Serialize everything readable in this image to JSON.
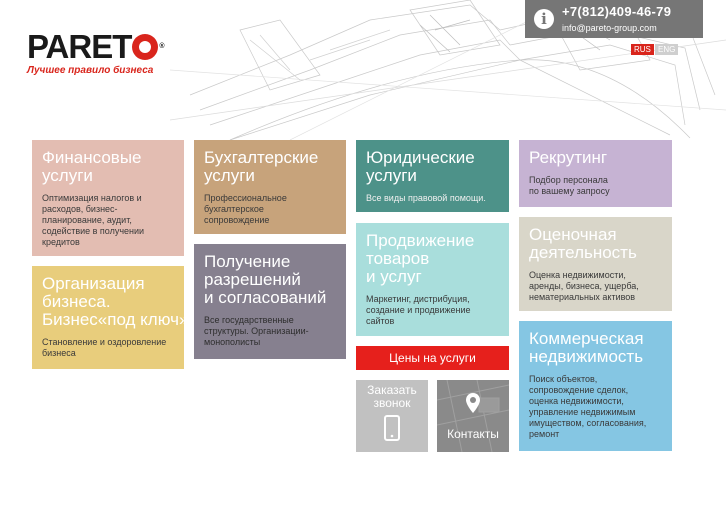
{
  "brand": {
    "logo_text": "PARETO",
    "logo_reg": "®",
    "tagline": "Лучшее правило бизнеса"
  },
  "contact": {
    "phone": "+7(812)409-46-79",
    "email": "info@pareto-group.com",
    "info_icon": "info-icon"
  },
  "languages": {
    "rus": "RUS",
    "eng": "ENG"
  },
  "tiles": {
    "finance": {
      "title": "Финансовые\nуслуги",
      "desc": "Оптимизация налогов и\nрасходов, бизнес-\nпланирование, аудит,\nсодействие в получении\nкредитов",
      "color": "#e3bdb2"
    },
    "business": {
      "title": "Организация\nбизнеса.\nБизнес«под ключ»",
      "desc": "Становление и оздоровление\nбизнеса",
      "color": "#e8cd7c"
    },
    "accounting": {
      "title": "Бухгалтерские\nуслуги",
      "desc": "Профессиональное\nбухгалтерское\nсопровождение",
      "color": "#c7a37b"
    },
    "permits": {
      "title": "Получение\nразрешений\nи согласований",
      "desc": "Все государственные\nструктуры. Организации-\nмонополисты",
      "color": "#86808f"
    },
    "legal": {
      "title": "Юридические\nуслуги",
      "desc": "Все виды правовой помощи.",
      "color": "#4d9289"
    },
    "promotion": {
      "title": "Продвижение\nтоваров\nи услуг",
      "desc": "Маркетинг, дистрибуция,\nсоздание и продвижение\nсайтов",
      "color": "#a9dedc"
    },
    "recruiting": {
      "title": "Рекрутинг",
      "desc": "Подбор персонала\nпо вашему запросу",
      "color": "#c6b3d3"
    },
    "valuation": {
      "title": "Оценочная\nдеятельность",
      "desc": "Оценка недвижимости,\nаренды, бизнеса, ущерба,\nнематериальных активов",
      "color": "#d9d6c9"
    },
    "realestate": {
      "title": "Коммерческая\nнедвижимость",
      "desc": "Поиск объектов,\nсопровождение сделок,\nоценка недвижимости,\nуправление недвижимым\nимуществом, согласования,\nремонт",
      "color": "#85c6e3"
    }
  },
  "actions": {
    "prices": "Цены на услуги",
    "call": "Заказать\nзвонок",
    "contacts": "Контакты"
  }
}
